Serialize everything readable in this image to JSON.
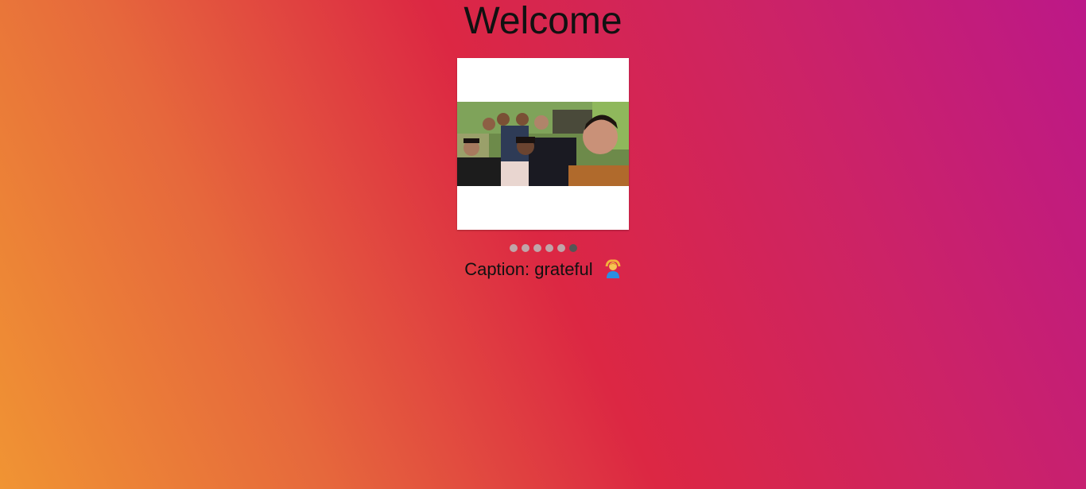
{
  "header": {
    "title": "Welcome"
  },
  "carousel": {
    "slide_count": 6,
    "active_index": 5,
    "image_alt": "group selfie",
    "image_icon": "photo-group-selfie"
  },
  "caption": {
    "label": "Caption:",
    "text": "grateful",
    "emoji_icon": "person-gesturing-ok-icon"
  },
  "colors": {
    "gradient_start": "#f09433",
    "gradient_mid": "#dc2743",
    "gradient_end": "#bc1888",
    "dot_inactive": "#bbbbbb",
    "dot_active": "#555555"
  }
}
